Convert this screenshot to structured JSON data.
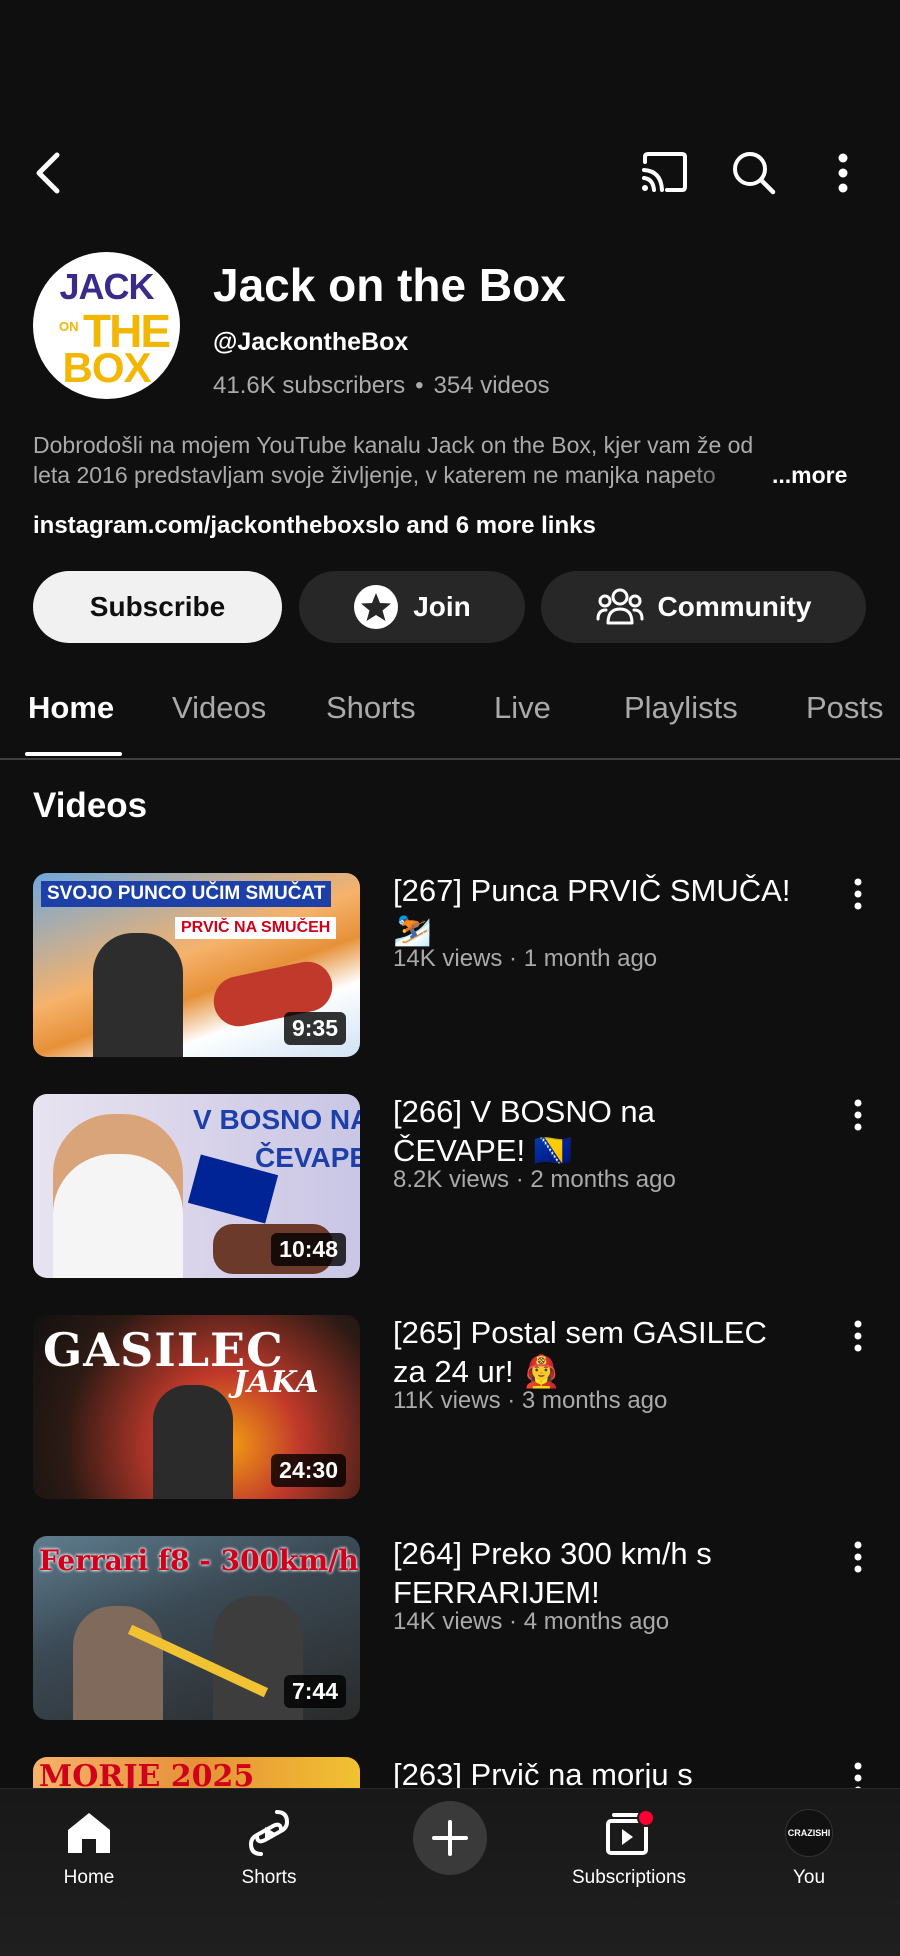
{
  "channel": {
    "name": "Jack on the Box",
    "handle": "@JackontheBox",
    "subscribers": "41.6K subscribers",
    "stats_separator": "•",
    "videos_count": "354 videos",
    "description_line1": "Dobrodošli na mojem YouTube kanalu Jack on the Box, kjer vam že od",
    "description_line2": "leta 2016 predstavljam svoje življenje, v katerem ne manjka napeto",
    "more_label": "...more",
    "links_text": "instagram.com/jackontheboxslo and 6 more links",
    "avatar_logo": {
      "line1": "JACK",
      "on": "ON",
      "line2": "THE",
      "line3": "BOX"
    }
  },
  "actions": {
    "subscribe": "Subscribe",
    "join": "Join",
    "community": "Community"
  },
  "tabs": [
    "Home",
    "Videos",
    "Shorts",
    "Live",
    "Playlists",
    "Posts"
  ],
  "section_title": "Videos",
  "videos": [
    {
      "title": "[267] Punca PRVIČ SMUČA! ⛷️",
      "meta": "14K views · 1 month ago",
      "duration": "9:35",
      "thumb_text1": "SVOJO PUNCO UČIM SMUČAT",
      "thumb_text2": "PRVIČ NA SMUČEH"
    },
    {
      "title": "[266] V BOSNO na ČEVAPE! 🇧🇦",
      "meta": "8.2K views · 2 months ago",
      "duration": "10:48",
      "thumb_text1": "V BOSNO NA",
      "thumb_text2": "ČEVAPE"
    },
    {
      "title": "[265] Postal sem GASILEC za 24 ur! 👩‍🚒",
      "meta": "11K views · 3 months ago",
      "duration": "24:30",
      "thumb_text1": "GASILEC",
      "thumb_text2": "JAKA"
    },
    {
      "title": "[264] Preko 300 km/h s FERRARIJEM!",
      "meta": "14K views · 4 months ago",
      "duration": "7:44",
      "thumb_text1": "Ferrari f8 - 300km/h",
      "thumb_text2": ""
    },
    {
      "title": "[263] Prvič na morju s",
      "meta": "",
      "duration": "",
      "thumb_text1": "MORJE 2025",
      "thumb_text2": ""
    }
  ],
  "bottom_nav": {
    "home": "Home",
    "shorts": "Shorts",
    "subscriptions": "Subscriptions",
    "you": "You",
    "you_avatar_text": "CRAZISHI"
  },
  "colors": {
    "background": "#0f0f0f",
    "pill": "#272727",
    "secondary_text": "#aaaaaa",
    "notification": "#ff0033"
  }
}
